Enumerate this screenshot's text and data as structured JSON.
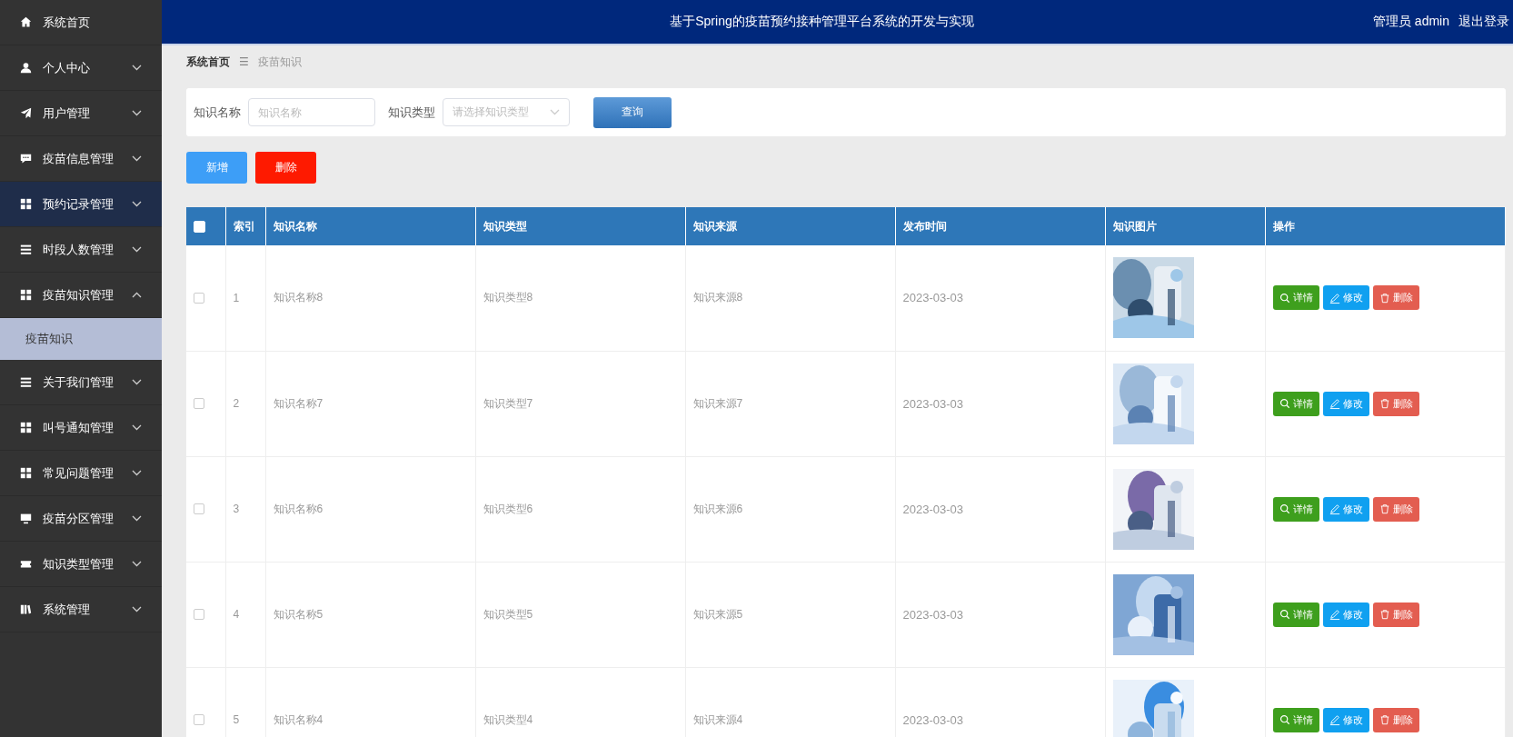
{
  "sidebar": {
    "items": [
      {
        "label": "系统首页",
        "has_arrow": false,
        "hovered": false
      },
      {
        "label": "个人中心",
        "has_arrow": true,
        "expanded": false,
        "hovered": false
      },
      {
        "label": "用户管理",
        "has_arrow": true,
        "expanded": false,
        "hovered": false
      },
      {
        "label": "疫苗信息管理",
        "has_arrow": true,
        "expanded": false,
        "hovered": false
      },
      {
        "label": "预约记录管理",
        "has_arrow": true,
        "expanded": false,
        "hovered": true
      },
      {
        "label": "时段人数管理",
        "has_arrow": true,
        "expanded": false,
        "hovered": false
      },
      {
        "label": "疫苗知识管理",
        "has_arrow": true,
        "expanded": true,
        "hovered": false,
        "children": [
          {
            "label": "疫苗知识",
            "selected": true
          }
        ]
      },
      {
        "label": "关于我们管理",
        "has_arrow": true,
        "expanded": false,
        "hovered": false
      },
      {
        "label": "叫号通知管理",
        "has_arrow": true,
        "expanded": false,
        "hovered": false
      },
      {
        "label": "常见问题管理",
        "has_arrow": true,
        "expanded": false,
        "hovered": false
      },
      {
        "label": "疫苗分区管理",
        "has_arrow": true,
        "expanded": false,
        "hovered": false
      },
      {
        "label": "知识类型管理",
        "has_arrow": true,
        "expanded": false,
        "hovered": false
      },
      {
        "label": "系统管理",
        "has_arrow": true,
        "expanded": false,
        "hovered": false
      }
    ]
  },
  "header": {
    "title": "基于Spring的疫苗预约接种管理平台系统的开发与实现",
    "user": "管理员 admin",
    "logout": "退出登录"
  },
  "breadcrumb": {
    "items": [
      "系统首页",
      "疫苗知识"
    ],
    "separator": "☰"
  },
  "search": {
    "fields": [
      {
        "kind": "input",
        "label": "知识名称",
        "placeholder": "知识名称"
      },
      {
        "kind": "select",
        "label": "知识类型",
        "placeholder": "请选择知识类型"
      }
    ],
    "button": "查询"
  },
  "actions": [
    {
      "kind": "add",
      "label": "新增"
    },
    {
      "kind": "delete",
      "label": "删除"
    }
  ],
  "table": {
    "all_checked": false,
    "columns": [
      "索引",
      "知识名称",
      "知识类型",
      "知识来源",
      "发布时间",
      "知识图片",
      "操作"
    ],
    "rows": [
      {
        "checked": false,
        "index": "1",
        "name": "知识名称8",
        "type": "知识类型8",
        "source": "知识来源8",
        "time": "2023-03-03",
        "buttons": [
          {
            "kind": "detail",
            "label": "详情"
          },
          {
            "kind": "edit",
            "label": "修改"
          },
          {
            "kind": "delete",
            "label": "删除"
          }
        ]
      },
      {
        "checked": false,
        "index": "2",
        "name": "知识名称7",
        "type": "知识类型7",
        "source": "知识来源7",
        "time": "2023-03-03",
        "buttons": [
          {
            "kind": "detail",
            "label": "详情"
          },
          {
            "kind": "edit",
            "label": "修改"
          },
          {
            "kind": "delete",
            "label": "删除"
          }
        ]
      },
      {
        "checked": false,
        "index": "3",
        "name": "知识名称6",
        "type": "知识类型6",
        "source": "知识来源6",
        "time": "2023-03-03",
        "buttons": [
          {
            "kind": "detail",
            "label": "详情"
          },
          {
            "kind": "edit",
            "label": "修改"
          },
          {
            "kind": "delete",
            "label": "删除"
          }
        ]
      },
      {
        "checked": false,
        "index": "4",
        "name": "知识名称5",
        "type": "知识类型5",
        "source": "知识来源5",
        "time": "2023-03-03",
        "buttons": [
          {
            "kind": "detail",
            "label": "详情"
          },
          {
            "kind": "edit",
            "label": "修改"
          },
          {
            "kind": "delete",
            "label": "删除"
          }
        ]
      },
      {
        "checked": false,
        "index": "5",
        "name": "知识名称4",
        "type": "知识类型4",
        "source": "知识来源4",
        "time": "2023-03-03",
        "buttons": [
          {
            "kind": "detail",
            "label": "详情"
          },
          {
            "kind": "edit",
            "label": "修改"
          },
          {
            "kind": "delete",
            "label": "删除"
          }
        ]
      }
    ]
  }
}
